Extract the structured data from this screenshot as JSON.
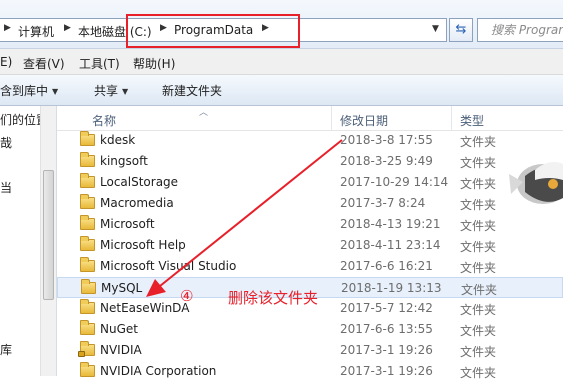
{
  "address": {
    "crumbs": [
      "计算机",
      "本地磁盘 (C:)",
      "ProgramData"
    ],
    "search_placeholder": "搜索 ProgramData"
  },
  "menu": [
    "E)",
    "查看(V)",
    "工具(T)",
    "帮助(H)"
  ],
  "toolbar": {
    "include_label": "含到库中",
    "share_label": "共享",
    "new_folder_label": "新建文件夹"
  },
  "nav_pane": [
    "们的位置",
    "哉",
    "当",
    "库"
  ],
  "columns": {
    "name": "名称",
    "modified": "修改日期",
    "type": "类型"
  },
  "files": [
    {
      "name": "kdesk",
      "date": "2018-3-8 17:55",
      "type": "文件夹"
    },
    {
      "name": "kingsoft",
      "date": "2018-3-25 9:49",
      "type": "文件夹"
    },
    {
      "name": "LocalStorage",
      "date": "2017-10-29 14:14",
      "type": "文件夹"
    },
    {
      "name": "Macromedia",
      "date": "2017-3-7 8:24",
      "type": "文件夹"
    },
    {
      "name": "Microsoft",
      "date": "2018-4-13 19:21",
      "type": "文件夹"
    },
    {
      "name": "Microsoft Help",
      "date": "2018-4-11 23:14",
      "type": "文件夹"
    },
    {
      "name": "Microsoft Visual Studio",
      "date": "2017-6-6 16:21",
      "type": "文件夹"
    },
    {
      "name": "MySQL",
      "date": "2018-1-19 13:13",
      "type": "文件夹"
    },
    {
      "name": "NetEaseWinDA",
      "date": "2017-5-7 12:42",
      "type": "文件夹"
    },
    {
      "name": "NuGet",
      "date": "2017-6-6 13:55",
      "type": "文件夹"
    },
    {
      "name": "NVIDIA",
      "date": "2017-3-1 19:26",
      "type": "文件夹"
    },
    {
      "name": "NVIDIA Corporation",
      "date": "2017-3-1 19:26",
      "type": "文件夹"
    }
  ],
  "annotation": {
    "number": "④",
    "text": "删除该文件夹",
    "color": "#e8202a"
  }
}
